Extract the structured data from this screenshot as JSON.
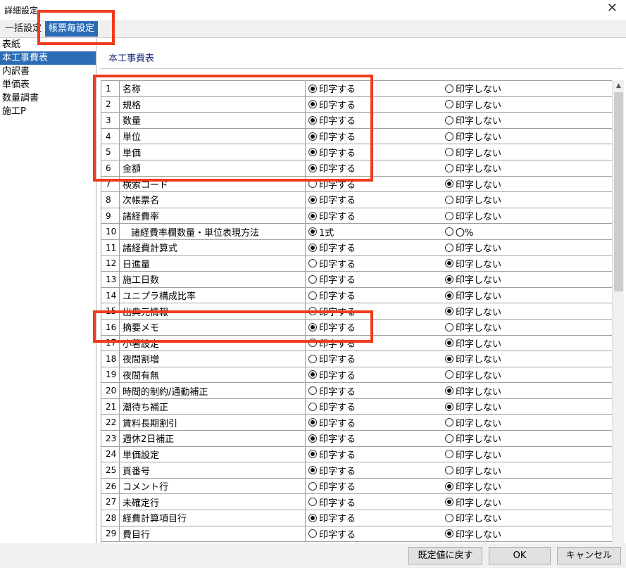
{
  "window": {
    "title": "詳細設定",
    "close_glyph": "✕"
  },
  "tabs": {
    "bulk": "一括設定",
    "per_form": "帳票毎設定"
  },
  "nav": [
    "表紙",
    "本工事費表",
    "内訳書",
    "単価表",
    "数量調書",
    "施工P"
  ],
  "nav_selected": 1,
  "section_title": "本工事費表",
  "rows": [
    {
      "n": "1",
      "name": "名称",
      "on": "印字する",
      "off": "印字しない",
      "sel": "on"
    },
    {
      "n": "2",
      "name": "規格",
      "on": "印字する",
      "off": "印字しない",
      "sel": "on"
    },
    {
      "n": "3",
      "name": "数量",
      "on": "印字する",
      "off": "印字しない",
      "sel": "on"
    },
    {
      "n": "4",
      "name": "単位",
      "on": "印字する",
      "off": "印字しない",
      "sel": "on"
    },
    {
      "n": "5",
      "name": "単価",
      "on": "印字する",
      "off": "印字しない",
      "sel": "on"
    },
    {
      "n": "6",
      "name": "金額",
      "on": "印字する",
      "off": "印字しない",
      "sel": "on"
    },
    {
      "n": "7",
      "name": "検索コード",
      "on": "印字する",
      "off": "印字しない",
      "sel": "off"
    },
    {
      "n": "8",
      "name": "次帳票名",
      "on": "印字する",
      "off": "印字しない",
      "sel": "on"
    },
    {
      "n": "9",
      "name": "諸経費率",
      "on": "印字する",
      "off": "印字しない",
      "sel": "on"
    },
    {
      "n": "10",
      "name": "諸経費率欄数量・単位表現方法",
      "on": "1式",
      "off": "〇%",
      "sel": "on",
      "indent": true
    },
    {
      "n": "11",
      "name": "諸経費計算式",
      "on": "印字する",
      "off": "印字しない",
      "sel": "on"
    },
    {
      "n": "12",
      "name": "日進量",
      "on": "印字する",
      "off": "印字しない",
      "sel": "off"
    },
    {
      "n": "13",
      "name": "施工日数",
      "on": "印字する",
      "off": "印字しない",
      "sel": "off"
    },
    {
      "n": "14",
      "name": "ユニプラ構成比率",
      "on": "印字する",
      "off": "印字しない",
      "sel": "off"
    },
    {
      "n": "15",
      "name": "出典元情報",
      "on": "印字する",
      "off": "印字しない",
      "sel": "off"
    },
    {
      "n": "16",
      "name": "摘要メモ",
      "on": "印字する",
      "off": "印字しない",
      "sel": "on"
    },
    {
      "n": "17",
      "name": "小著設定",
      "on": "印字する",
      "off": "印字しない",
      "sel": "off"
    },
    {
      "n": "18",
      "name": "夜間割増",
      "on": "印字する",
      "off": "印字しない",
      "sel": "off"
    },
    {
      "n": "19",
      "name": "夜間有無",
      "on": "印字する",
      "off": "印字しない",
      "sel": "on"
    },
    {
      "n": "20",
      "name": "時間的制約/通勤補正",
      "on": "印字する",
      "off": "印字しない",
      "sel": "off"
    },
    {
      "n": "21",
      "name": "潮待ち補正",
      "on": "印字する",
      "off": "印字しない",
      "sel": "off"
    },
    {
      "n": "22",
      "name": "賃料長期割引",
      "on": "印字する",
      "off": "印字しない",
      "sel": "on"
    },
    {
      "n": "23",
      "name": "週休2日補正",
      "on": "印字する",
      "off": "印字しない",
      "sel": "on"
    },
    {
      "n": "24",
      "name": "単価設定",
      "on": "印字する",
      "off": "印字しない",
      "sel": "on"
    },
    {
      "n": "25",
      "name": "頁番号",
      "on": "印字する",
      "off": "印字しない",
      "sel": "on"
    },
    {
      "n": "26",
      "name": "コメント行",
      "on": "印字する",
      "off": "印字しない",
      "sel": "off"
    },
    {
      "n": "27",
      "name": "未確定行",
      "on": "印字する",
      "off": "印字しない",
      "sel": "off"
    },
    {
      "n": "28",
      "name": "経費計算項目行",
      "on": "印字する",
      "off": "印字しない",
      "sel": "on"
    },
    {
      "n": "29",
      "name": "費目行",
      "on": "印字する",
      "off": "印字しない",
      "sel": "off"
    }
  ],
  "buttons": {
    "reset": "既定値に戻す",
    "ok": "OK",
    "cancel": "キャンセル"
  },
  "colors": {
    "selected": "#2b6cb5",
    "highlight": "#f03c1e",
    "section_title": "#1a2a7a"
  },
  "icons": {
    "scroll_up": "▲"
  }
}
